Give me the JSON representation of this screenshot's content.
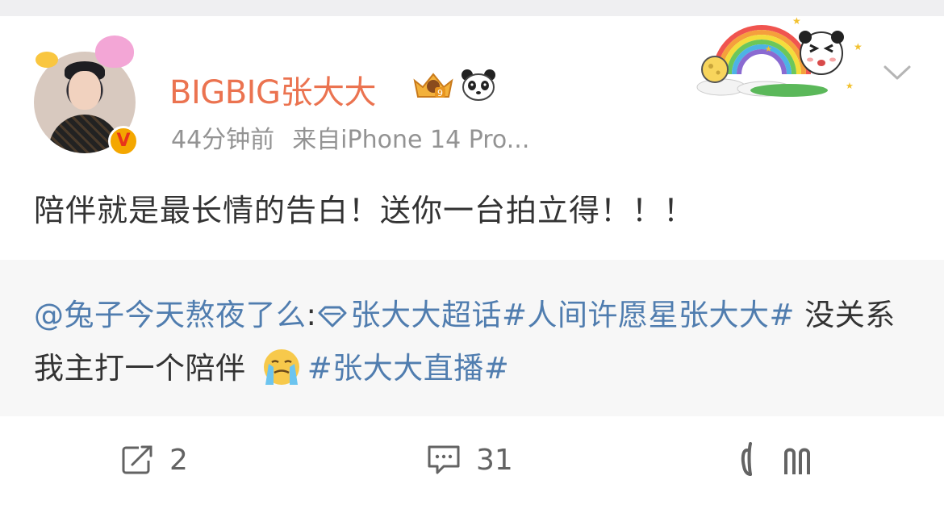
{
  "post": {
    "author": {
      "name": "BIGBIG张大大"
    },
    "meta": {
      "time": "44分钟前",
      "source": "来自iPhone 14 Pro..."
    },
    "text": "陪伴就是最长情的告白！送你一台拍立得！！！"
  },
  "repost": {
    "mention": "@兔子今天熬夜了么",
    "colon": ":",
    "supertopic": "张大大超话",
    "topic1": "#人间许愿星张大大#",
    "plain": " 没关系 我主打一个陪伴 ",
    "topic2": "#张大大直播#"
  },
  "actions": {
    "repost_count": "2",
    "comment_count": "31"
  },
  "colors": {
    "username": "#eb7350",
    "link": "#507daf",
    "meta": "#939393",
    "text": "#333333"
  },
  "icons": {
    "vip_badge": "V",
    "crown_badge": "crown-badge-icon",
    "panda_badge": "panda-icon",
    "sticker": "rainbow-panda-sticker",
    "menu": "chevron-down-icon",
    "repost": "repost-icon",
    "comment": "comment-icon",
    "like": "like-icon"
  }
}
